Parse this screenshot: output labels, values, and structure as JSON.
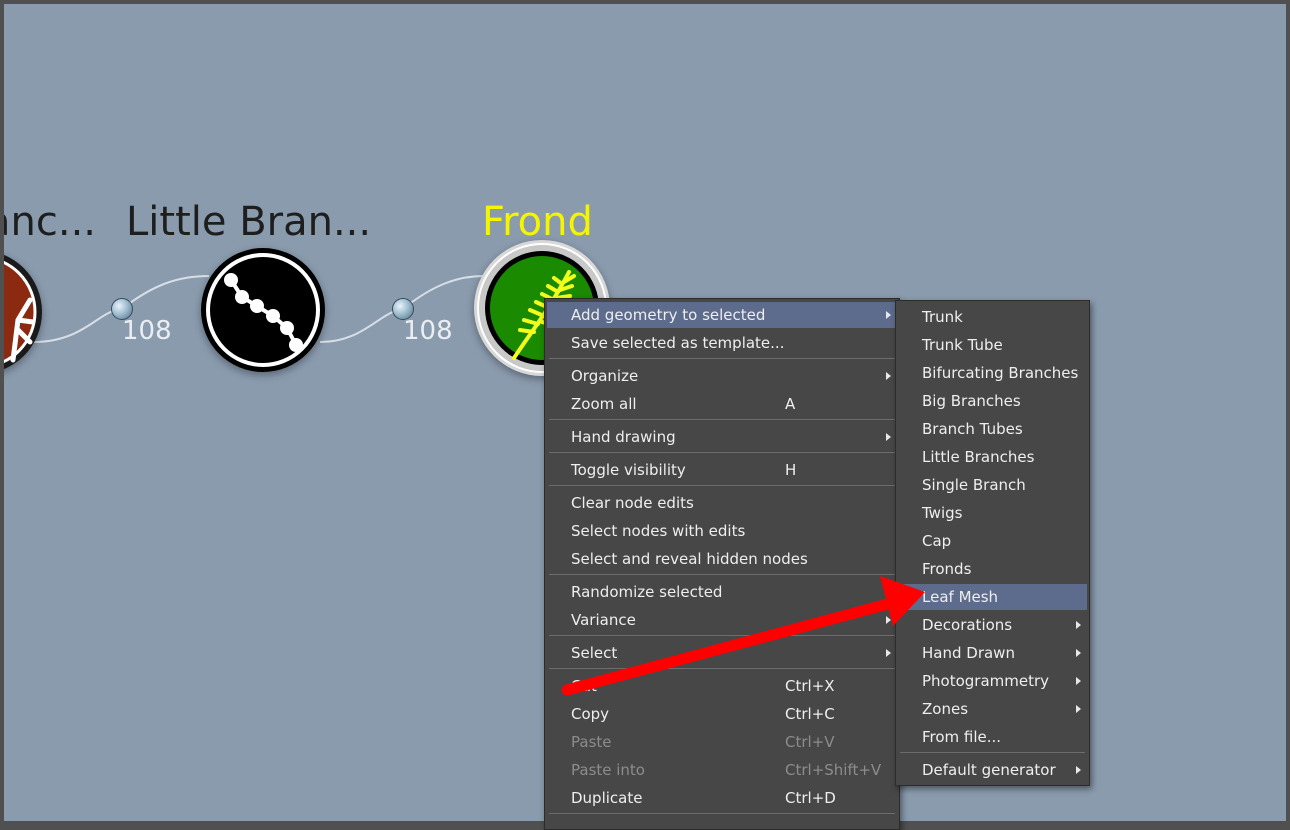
{
  "nodes": {
    "partial_title": "anc...",
    "little_branches_title": "Little Bran...",
    "frond_title": "Frond"
  },
  "connections": [
    {
      "count": "108"
    },
    {
      "count": "108"
    }
  ],
  "context_menu": {
    "add_geometry": "Add geometry to selected",
    "save_template": "Save selected as template...",
    "organize": "Organize",
    "zoom_all": "Zoom all",
    "zoom_all_shortcut": "A",
    "hand_drawing": "Hand drawing",
    "toggle_visibility": "Toggle visibility",
    "toggle_visibility_shortcut": "H",
    "clear_node_edits": "Clear node edits",
    "select_nodes_with_edits": "Select nodes with edits",
    "select_reveal_hidden": "Select and reveal hidden nodes",
    "randomize_selected": "Randomize selected",
    "variance": "Variance",
    "select": "Select",
    "cut": "Cut",
    "cut_shortcut": "Ctrl+X",
    "copy": "Copy",
    "copy_shortcut": "Ctrl+C",
    "paste": "Paste",
    "paste_shortcut": "Ctrl+V",
    "paste_into": "Paste into",
    "paste_into_shortcut": "Ctrl+Shift+V",
    "duplicate": "Duplicate",
    "duplicate_shortcut": "Ctrl+D"
  },
  "submenu": {
    "trunk": "Trunk",
    "trunk_tube": "Trunk Tube",
    "bifurcating_branches": "Bifurcating Branches",
    "big_branches": "Big Branches",
    "branch_tubes": "Branch Tubes",
    "little_branches": "Little Branches",
    "single_branch": "Single Branch",
    "twigs": "Twigs",
    "cap": "Cap",
    "fronds": "Fronds",
    "leaf_mesh": "Leaf Mesh",
    "decorations": "Decorations",
    "hand_drawn": "Hand Drawn",
    "photogrammetry": "Photogrammetry",
    "zones": "Zones",
    "from_file": "From file...",
    "default_generator": "Default generator"
  },
  "colors": {
    "canvas": "#8a9bae",
    "selected_title": "#f5f500",
    "menu_bg": "#474747",
    "menu_highlight": "#5d6b8c",
    "annotation_arrow": "#ff0000"
  }
}
